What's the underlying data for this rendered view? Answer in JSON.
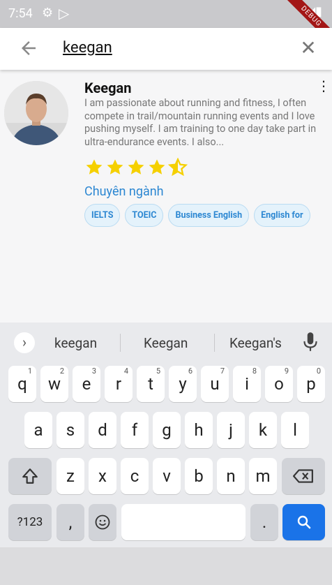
{
  "status_bar": {
    "time": "7:54",
    "debug_label": "DEBUG"
  },
  "app_bar": {
    "search_query": "keegan"
  },
  "result": {
    "name": "Keegan",
    "bio": "I am passionate about running and fitness, I often compete in trail/mountain running events and I love pushing myself. I am training to one day take part in ultra-endurance events. I also...",
    "rating": 4.5,
    "specialties_label": "Chuyên ngành",
    "specialties": [
      "IELTS",
      "TOEIC",
      "Business English",
      "English for"
    ]
  },
  "keyboard": {
    "suggestions": [
      "keegan",
      "Keegan",
      "Keegan's"
    ],
    "row1": [
      {
        "k": "q",
        "h": "1"
      },
      {
        "k": "w",
        "h": "2"
      },
      {
        "k": "e",
        "h": "3"
      },
      {
        "k": "r",
        "h": "4"
      },
      {
        "k": "t",
        "h": "5"
      },
      {
        "k": "y",
        "h": "6"
      },
      {
        "k": "u",
        "h": "7"
      },
      {
        "k": "i",
        "h": "8"
      },
      {
        "k": "o",
        "h": "9"
      },
      {
        "k": "p",
        "h": "0"
      }
    ],
    "row2": [
      "a",
      "s",
      "d",
      "f",
      "g",
      "h",
      "j",
      "k",
      "l"
    ],
    "row3": [
      "z",
      "x",
      "c",
      "v",
      "b",
      "n",
      "m"
    ],
    "symbols_key": "?123",
    "comma_key": ",",
    "period_key": "."
  },
  "colors": {
    "accent": "#2c87d2",
    "star": "#f5d000",
    "search_key": "#1a73e8"
  }
}
